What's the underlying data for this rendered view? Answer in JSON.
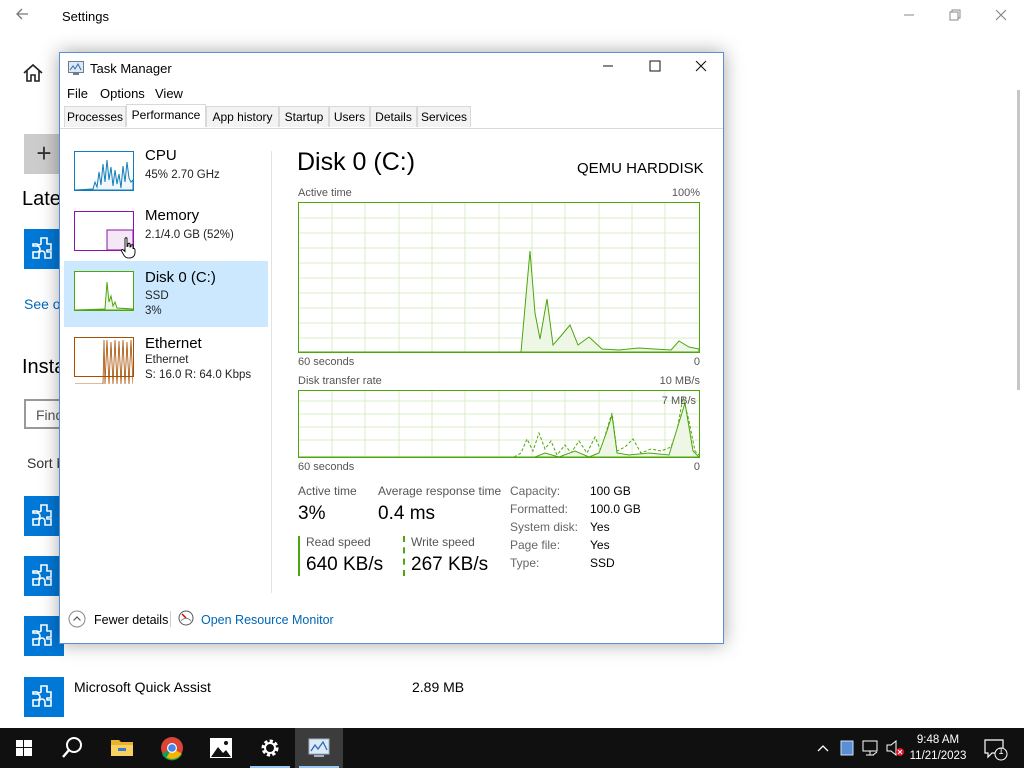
{
  "settings": {
    "title": "Settings",
    "latest_heading": "Late",
    "see_link": "See o",
    "installed_heading": "Insta",
    "find_placeholder": "Find",
    "sort_label": "Sort b",
    "quick_assist": {
      "name": "Microsoft Quick Assist",
      "size": "2.89 MB"
    }
  },
  "task_manager": {
    "title": "Task Manager",
    "menu": [
      "File",
      "Options",
      "View"
    ],
    "tabs": [
      "Processes",
      "Performance",
      "App history",
      "Startup",
      "Users",
      "Details",
      "Services"
    ],
    "active_tab": "Performance",
    "resources": [
      {
        "name": "CPU",
        "line1": "45%  2.70 GHz",
        "line2": ""
      },
      {
        "name": "Memory",
        "line1": "2.1/4.0 GB (52%)",
        "line2": ""
      },
      {
        "name": "Disk 0 (C:)",
        "line1": "SSD",
        "line2": "3%"
      },
      {
        "name": "Ethernet",
        "line1": "Ethernet",
        "line2": "S: 16.0  R: 64.0 Kbps"
      }
    ],
    "detail": {
      "title": "Disk 0 (C:)",
      "model": "QEMU HARDDISK",
      "graph1": {
        "label": "Active time",
        "max": "100%",
        "time": "60 seconds",
        "min": "0"
      },
      "graph2": {
        "label": "Disk transfer rate",
        "max": "10 MB/s",
        "inner": "7 MB/s",
        "time": "60 seconds",
        "min": "0"
      },
      "stats": {
        "active_time_label": "Active time",
        "active_time": "3%",
        "avg_resp_label": "Average response time",
        "avg_resp": "0.4 ms",
        "read_label": "Read speed",
        "read": "640 KB/s",
        "write_label": "Write speed",
        "write": "267 KB/s"
      },
      "props": [
        {
          "k": "Capacity:",
          "v": "100 GB"
        },
        {
          "k": "Formatted:",
          "v": "100.0 GB"
        },
        {
          "k": "System disk:",
          "v": "Yes"
        },
        {
          "k": "Page file:",
          "v": "Yes"
        },
        {
          "k": "Type:",
          "v": "SSD"
        }
      ]
    },
    "footer": {
      "fewer": "Fewer details",
      "monitor": "Open Resource Monitor"
    }
  },
  "taskbar": {
    "time": "9:48 AM",
    "date": "11/21/2023",
    "notification_count": "1"
  },
  "colors": {
    "disk_green": "#4da60c",
    "cpu_blue": "#117dbb",
    "mem_purple": "#8b12ae",
    "net_orange": "#a74f01",
    "accent": "#0078d7"
  }
}
